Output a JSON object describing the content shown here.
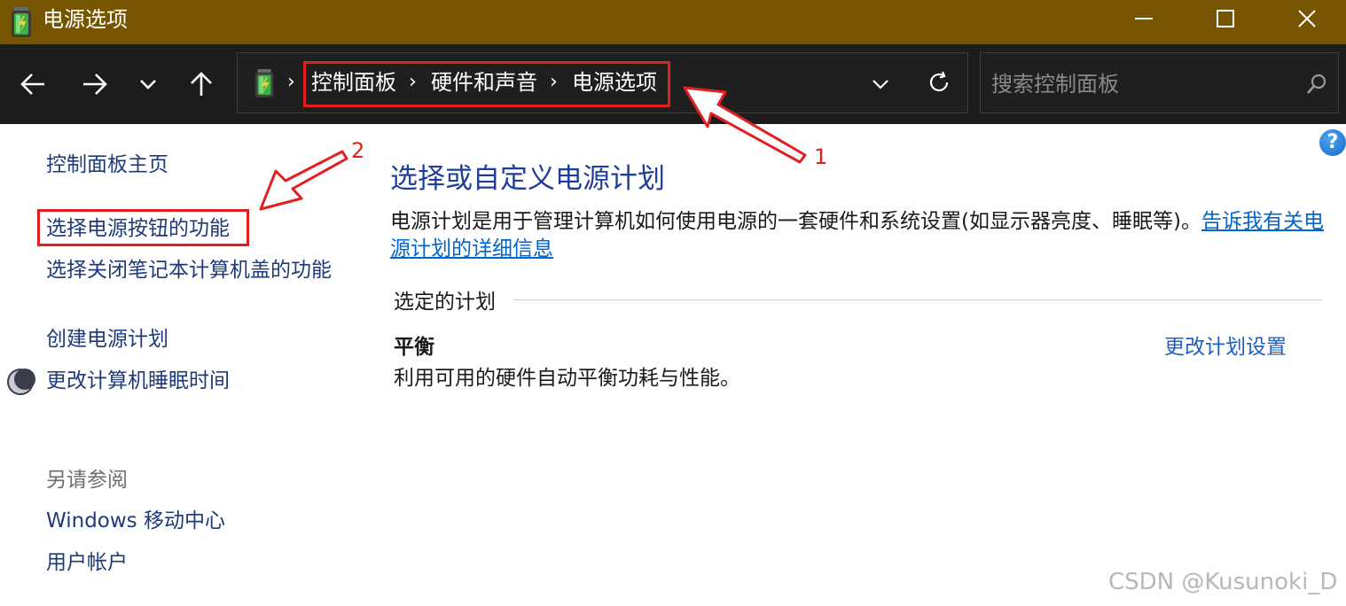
{
  "window": {
    "title": "电源选项",
    "icon": "battery-power-icon",
    "controls": [
      "minimize-icon",
      "maximize-icon",
      "close-icon"
    ]
  },
  "nav": {
    "buttons": [
      "back-arrow-icon",
      "forward-arrow-icon",
      "history-chevron-icon",
      "up-arrow-icon"
    ]
  },
  "address": {
    "breadcrumbs": [
      "控制面板",
      "硬件和声音",
      "电源选项"
    ],
    "separator": "›"
  },
  "search": {
    "placeholder": "搜索控制面板"
  },
  "help": {
    "label": "?"
  },
  "sidebar": {
    "home": "控制面板主页",
    "links": [
      "选择电源按钮的功能",
      "选择关闭笔记本计算机盖的功能",
      "创建电源计划",
      "更改计算机睡眠时间"
    ],
    "see_also_title": "另请参阅",
    "see_also": [
      "Windows 移动中心",
      "用户帐户"
    ]
  },
  "main": {
    "title": "选择或自定义电源计划",
    "description": "电源计划是用于管理计算机如何使用电源的一套硬件和系统设置(如显示器亮度、睡眠等)。",
    "learn_more_link": "告诉我有关电源计划的详细信息",
    "section_label": "选定的计划",
    "plan": {
      "name": "平衡",
      "description": "利用可用的硬件自动平衡功耗与性能。",
      "change_link": "更改计划设置"
    }
  },
  "annotations": {
    "marker_1": "1",
    "marker_2": "2",
    "color": "#e02020"
  },
  "watermark": "CSDN @Kusunoki_D",
  "colors": {
    "titlebar": "#775500",
    "navbar": "#1c1c1c",
    "link": "#1f3a7a",
    "title": "#1f3d9a"
  }
}
